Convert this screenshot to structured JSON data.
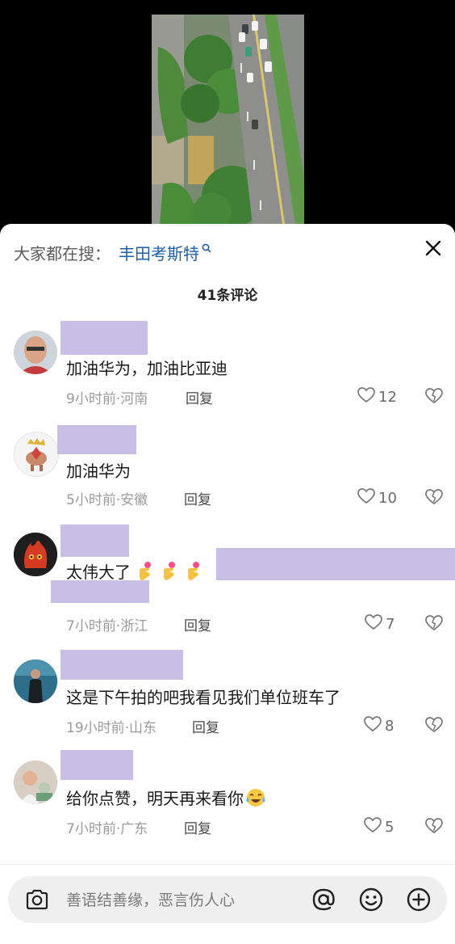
{
  "search": {
    "prefix": "大家都在搜：",
    "term": "丰田考斯特"
  },
  "comment_count": "41条评论",
  "comments": [
    {
      "text": "加油华为，加油比亚迪",
      "time_location": "9小时前·河南",
      "reply": "回复",
      "likes": "12"
    },
    {
      "text": "加油华为",
      "time_location": "5小时前·安徽",
      "reply": "回复",
      "likes": "10"
    },
    {
      "text": "太伟大了",
      "time_location": "7小时前·浙江",
      "reply": "回复",
      "likes": "7"
    },
    {
      "text": "这是下午拍的吧我看见我们单位班车了",
      "time_location": "19小时前·山东",
      "reply": "回复",
      "likes": "8"
    },
    {
      "text": "给你点赞，明天再来看你",
      "time_location": "7小时前·广东",
      "reply": "回复",
      "likes": "5"
    }
  ],
  "input": {
    "placeholder": "善语结善缘，恶言伤人心"
  },
  "colors": {
    "name_redaction": "#c9bfe6",
    "search_term": "#1f5fa8",
    "input_bg": "#efefef"
  },
  "icons": [
    "search-icon",
    "close-icon",
    "heart-icon",
    "dislike-icon",
    "camera-icon",
    "at-icon",
    "smile-icon",
    "plus-icon"
  ]
}
